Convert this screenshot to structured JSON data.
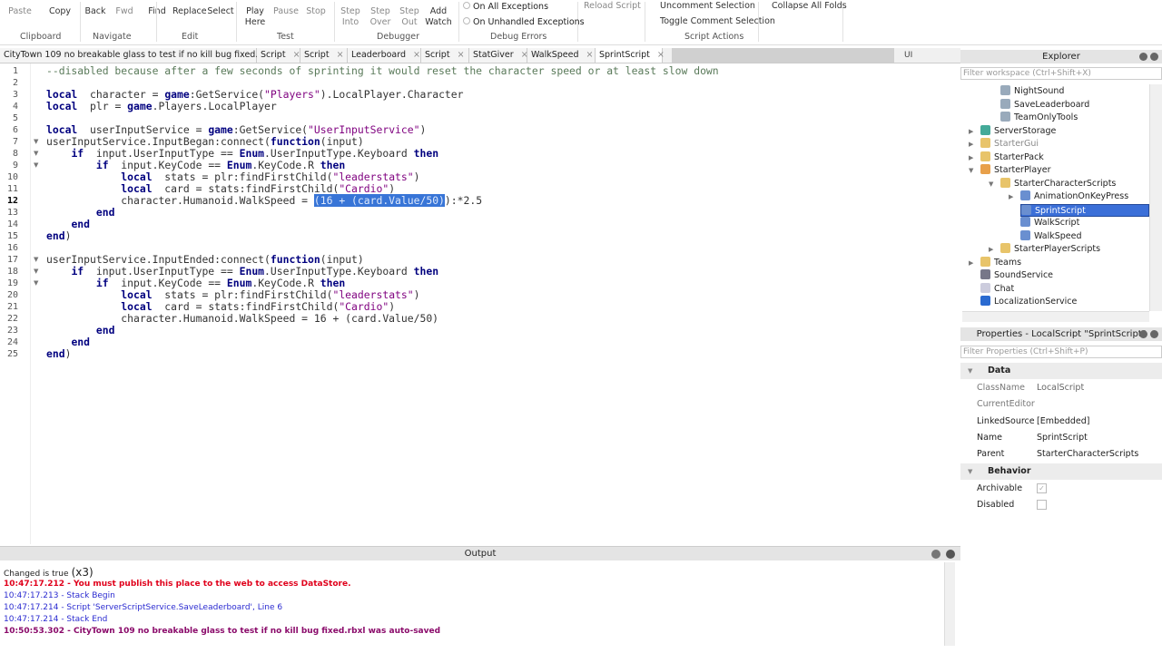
{
  "ribbon": {
    "buttons": [
      {
        "label": "Paste",
        "dim": true
      },
      {
        "label": "Copy"
      },
      {
        "label": "Back"
      },
      {
        "label": "Fwd",
        "dim": true
      },
      {
        "label": "Find"
      },
      {
        "label": "Replace"
      },
      {
        "label": "Select"
      },
      {
        "label": "Play\nHere"
      },
      {
        "label": "Pause",
        "dim": true
      },
      {
        "label": "Stop",
        "dim": true
      },
      {
        "label": "Step\nInto",
        "dim": true
      },
      {
        "label": "Step\nOver",
        "dim": true
      },
      {
        "label": "Step\nOut",
        "dim": true
      },
      {
        "label": "Add\nWatch"
      }
    ],
    "on_all_exceptions": "On All Exceptions",
    "on_unhandled_exceptions": "On Unhandled Exceptions",
    "reload_script": "Reload Script",
    "uncomment_selection": "Uncomment Selection",
    "toggle_comment_selection": "Toggle Comment Selection",
    "collapse_all_folds": "Collapse All Folds",
    "groups": [
      "Clipboard",
      "Navigate",
      "Edit",
      "Test",
      "Debugger",
      "Debug Errors",
      "Script Actions"
    ]
  },
  "tabs": [
    {
      "label": "CityTown 109 no breakable glass to test if no kill bug fixed.rbxl"
    },
    {
      "label": "Script"
    },
    {
      "label": "Script"
    },
    {
      "label": "Leaderboard"
    },
    {
      "label": "Script"
    },
    {
      "label": "StatGiver"
    },
    {
      "label": "WalkSpeed"
    },
    {
      "label": "SprintScript",
      "active": true
    }
  ],
  "tabbar_right": "UI",
  "editor": {
    "current_line": 12,
    "lines": [
      [
        [
          "cm",
          "--disabled because after a few seconds of sprinting it would reset the character speed or at least slow down"
        ]
      ],
      [],
      [
        [
          "kw",
          "local"
        ],
        [
          "",
          "  character = "
        ],
        [
          "kw",
          "game"
        ],
        [
          "",
          ":GetService("
        ],
        [
          "str",
          "\"Players\""
        ],
        [
          "",
          ").LocalPlayer.Character"
        ]
      ],
      [
        [
          "kw",
          "local"
        ],
        [
          "",
          "  plr = "
        ],
        [
          "kw",
          "game"
        ],
        [
          "",
          ".Players.LocalPlayer"
        ]
      ],
      [],
      [
        [
          "kw",
          "local"
        ],
        [
          "",
          "  userInputService = "
        ],
        [
          "kw",
          "game"
        ],
        [
          "",
          ":GetService("
        ],
        [
          "str",
          "\"UserInputService\""
        ],
        [
          "",
          ")"
        ]
      ],
      [
        [
          "",
          "userInputService.InputBegan:connect("
        ],
        [
          "kw",
          "function"
        ],
        [
          "",
          "(input)"
        ]
      ],
      [
        [
          "",
          "    "
        ],
        [
          "kw",
          "if"
        ],
        [
          "",
          "  input.UserInputType == "
        ],
        [
          "kw",
          "Enum"
        ],
        [
          "",
          ".UserInputType.Keyboard "
        ],
        [
          "kw",
          "then"
        ]
      ],
      [
        [
          "",
          "        "
        ],
        [
          "kw",
          "if"
        ],
        [
          "",
          "  input.KeyCode == "
        ],
        [
          "kw",
          "Enum"
        ],
        [
          "",
          ".KeyCode.R "
        ],
        [
          "kw",
          "then"
        ]
      ],
      [
        [
          "",
          "            "
        ],
        [
          "kw",
          "local"
        ],
        [
          "",
          "  stats = plr:findFirstChild("
        ],
        [
          "str",
          "\"leaderstats\""
        ],
        [
          "",
          ")"
        ]
      ],
      [
        [
          "",
          "            "
        ],
        [
          "kw",
          "local"
        ],
        [
          "",
          "  card = stats:findFirstChild("
        ],
        [
          "str",
          "\"Cardio\""
        ],
        [
          "",
          ")"
        ]
      ],
      [
        [
          "",
          "            character.Humanoid.WalkSpeed = "
        ],
        [
          "sel",
          "(16 + (card.Value/50)"
        ],
        [
          "",
          "):*2.5"
        ]
      ],
      [
        [
          "",
          "        "
        ],
        [
          "kw",
          "end"
        ]
      ],
      [
        [
          "",
          "    "
        ],
        [
          "kw",
          "end"
        ]
      ],
      [
        [
          "kw",
          "end"
        ],
        [
          "",
          ")"
        ]
      ],
      [],
      [
        [
          "",
          "userInputService.InputEnded:connect("
        ],
        [
          "kw",
          "function"
        ],
        [
          "",
          "(input)"
        ]
      ],
      [
        [
          "",
          "    "
        ],
        [
          "kw",
          "if"
        ],
        [
          "",
          "  input.UserInputType == "
        ],
        [
          "kw",
          "Enum"
        ],
        [
          "",
          ".UserInputType.Keyboard "
        ],
        [
          "kw",
          "then"
        ]
      ],
      [
        [
          "",
          "        "
        ],
        [
          "kw",
          "if"
        ],
        [
          "",
          "  input.KeyCode == "
        ],
        [
          "kw",
          "Enum"
        ],
        [
          "",
          ".KeyCode.R "
        ],
        [
          "kw",
          "then"
        ]
      ],
      [
        [
          "",
          "            "
        ],
        [
          "kw",
          "local"
        ],
        [
          "",
          "  stats = plr:findFirstChild("
        ],
        [
          "str",
          "\"leaderstats\""
        ],
        [
          "",
          ")"
        ]
      ],
      [
        [
          "",
          "            "
        ],
        [
          "kw",
          "local"
        ],
        [
          "",
          "  card = stats:findFirstChild("
        ],
        [
          "str",
          "\"Cardio\""
        ],
        [
          "",
          ")"
        ]
      ],
      [
        [
          "",
          "            character.Humanoid.WalkSpeed = 16 + (card.Value/50)"
        ]
      ],
      [
        [
          "",
          "        "
        ],
        [
          "kw",
          "end"
        ]
      ],
      [
        [
          "",
          "    "
        ],
        [
          "kw",
          "end"
        ]
      ],
      [
        [
          "kw",
          "end"
        ],
        [
          "",
          ")"
        ]
      ]
    ],
    "folds": [
      7,
      8,
      9,
      17,
      18,
      19
    ]
  },
  "output": {
    "title": "Output",
    "lines": [
      {
        "text": "Changed is true",
        "suffix": "(x3)",
        "style": ""
      },
      {
        "text": "10:47:17.212 - You must publish this place to the web to access DataStore.",
        "style": "red"
      },
      {
        "text": "10:47:17.213 - Stack Begin",
        "style": "blue"
      },
      {
        "text": "10:47:17.214 - Script 'ServerScriptService.SaveLeaderboard', Line 6",
        "style": "blue"
      },
      {
        "text": "10:47:17.214 - Stack End",
        "style": "blue"
      },
      {
        "text": "10:50:53.302 - CityTown 109 no breakable glass to test if no kill bug fixed.rbxl was auto-saved",
        "style": "purple"
      }
    ]
  },
  "explorer": {
    "title": "Explorer",
    "filter_placeholder": "Filter workspace (Ctrl+Shift+X)",
    "items": [
      {
        "label": "NightSound",
        "depth": 2,
        "icon": "script-icon",
        "color": "#9ab"
      },
      {
        "label": "SaveLeaderboard",
        "depth": 2,
        "icon": "script-icon",
        "color": "#9ab"
      },
      {
        "label": "TeamOnlyTools",
        "depth": 2,
        "icon": "script-icon",
        "color": "#9ab"
      },
      {
        "label": "ServerStorage",
        "depth": 1,
        "icon": "server-storage-icon",
        "arrow": "▶",
        "color": "#4a9"
      },
      {
        "label": "StarterGui",
        "depth": 1,
        "icon": "starter-gui-icon",
        "arrow": "▶",
        "color": "#e8c46a",
        "dim": true
      },
      {
        "label": "StarterPack",
        "depth": 1,
        "icon": "folder-icon",
        "arrow": "▶",
        "color": "#e8c46a"
      },
      {
        "label": "StarterPlayer",
        "depth": 1,
        "icon": "starter-player-icon",
        "arrow": "▼",
        "color": "#e8a04a"
      },
      {
        "label": "StarterCharacterScripts",
        "depth": 2,
        "icon": "folder-icon",
        "arrow": "▼",
        "color": "#e8c46a"
      },
      {
        "label": "AnimationOnKeyPress",
        "depth": 3,
        "icon": "local-script-icon",
        "arrow": "▶",
        "color": "#6a8fd0"
      },
      {
        "label": "SprintScript",
        "depth": 3,
        "icon": "local-script-icon",
        "color": "#6a8fd0",
        "selected": true
      },
      {
        "label": "WalkScript",
        "depth": 3,
        "icon": "local-script-icon",
        "color": "#6a8fd0"
      },
      {
        "label": "WalkSpeed",
        "depth": 3,
        "icon": "local-script-icon",
        "color": "#6a8fd0"
      },
      {
        "label": "StarterPlayerScripts",
        "depth": 2,
        "icon": "folder-icon",
        "arrow": "▶",
        "color": "#e8c46a"
      },
      {
        "label": "Teams",
        "depth": 1,
        "icon": "teams-icon",
        "arrow": "▶",
        "color": "#e8c46a"
      },
      {
        "label": "SoundService",
        "depth": 1,
        "icon": "sound-service-icon",
        "color": "#778"
      },
      {
        "label": "Chat",
        "depth": 1,
        "icon": "chat-icon",
        "color": "#ccd"
      },
      {
        "label": "LocalizationService",
        "depth": 1,
        "icon": "localization-service-icon",
        "color": "#2a6ad0"
      }
    ]
  },
  "properties": {
    "title": "Properties - LocalScript \"SprintScript\"",
    "filter_placeholder": "Filter Properties (Ctrl+Shift+P)",
    "categories": [
      {
        "name": "Data",
        "rows": [
          {
            "name": "ClassName",
            "value": "LocalScript",
            "dim": true
          },
          {
            "name": "CurrentEditor",
            "value": "",
            "dim": true
          },
          {
            "name": "LinkedSource",
            "value": "[Embedded]"
          },
          {
            "name": "Name",
            "value": "SprintScript"
          },
          {
            "name": "Parent",
            "value": "StarterCharacterScripts"
          }
        ]
      },
      {
        "name": "Behavior",
        "rows": [
          {
            "name": "Archivable",
            "checked": true
          },
          {
            "name": "Disabled",
            "checked": false
          }
        ]
      }
    ]
  }
}
